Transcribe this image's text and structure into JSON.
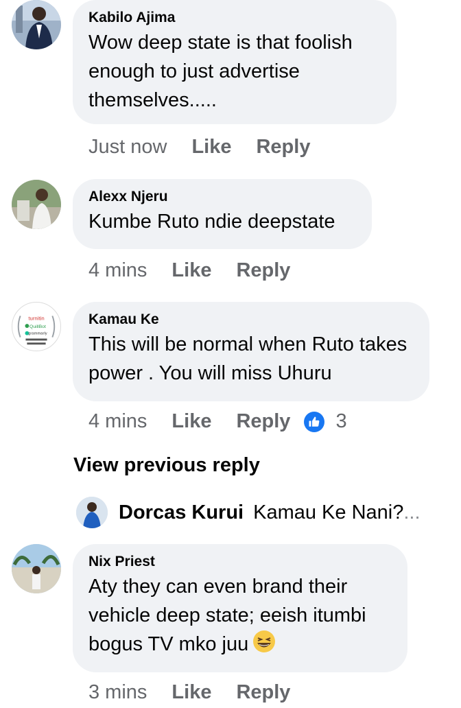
{
  "comments": [
    {
      "author": "Kabilo Ajima",
      "text": "Wow deep state is that foolish enough to just advertise themselves.....",
      "time": "Just now",
      "like_label": "Like",
      "reply_label": "Reply"
    },
    {
      "author": "Alexx Njeru",
      "text": "Kumbe Ruto ndie deepstate",
      "time": "4 mins",
      "like_label": "Like",
      "reply_label": "Reply"
    },
    {
      "author": "Kamau Ke",
      "text": "This will be normal when Ruto takes power . You will miss Uhuru",
      "time": "4 mins",
      "like_label": "Like",
      "reply_label": "Reply",
      "reaction_count": "3"
    },
    {
      "author": "Nix Priest",
      "text": "Aty they can even brand their vehicle deep state; eeish itumbi bogus TV mko juu",
      "time": "3 mins",
      "like_label": "Like",
      "reply_label": "Reply"
    }
  ],
  "avatar_logo": {
    "line1": "turnitin",
    "line2": "QuillBot",
    "line3": "grammarly"
  },
  "view_previous_reply": "View previous reply",
  "collapsed_reply": {
    "author": "Dorcas Kurui",
    "snippet": "Kamau Ke Nani?",
    "ellipsis": "..."
  },
  "colors": {
    "bubble_bg": "#f0f2f5",
    "meta_text": "#65676b",
    "like_blue": "#1877f2"
  }
}
